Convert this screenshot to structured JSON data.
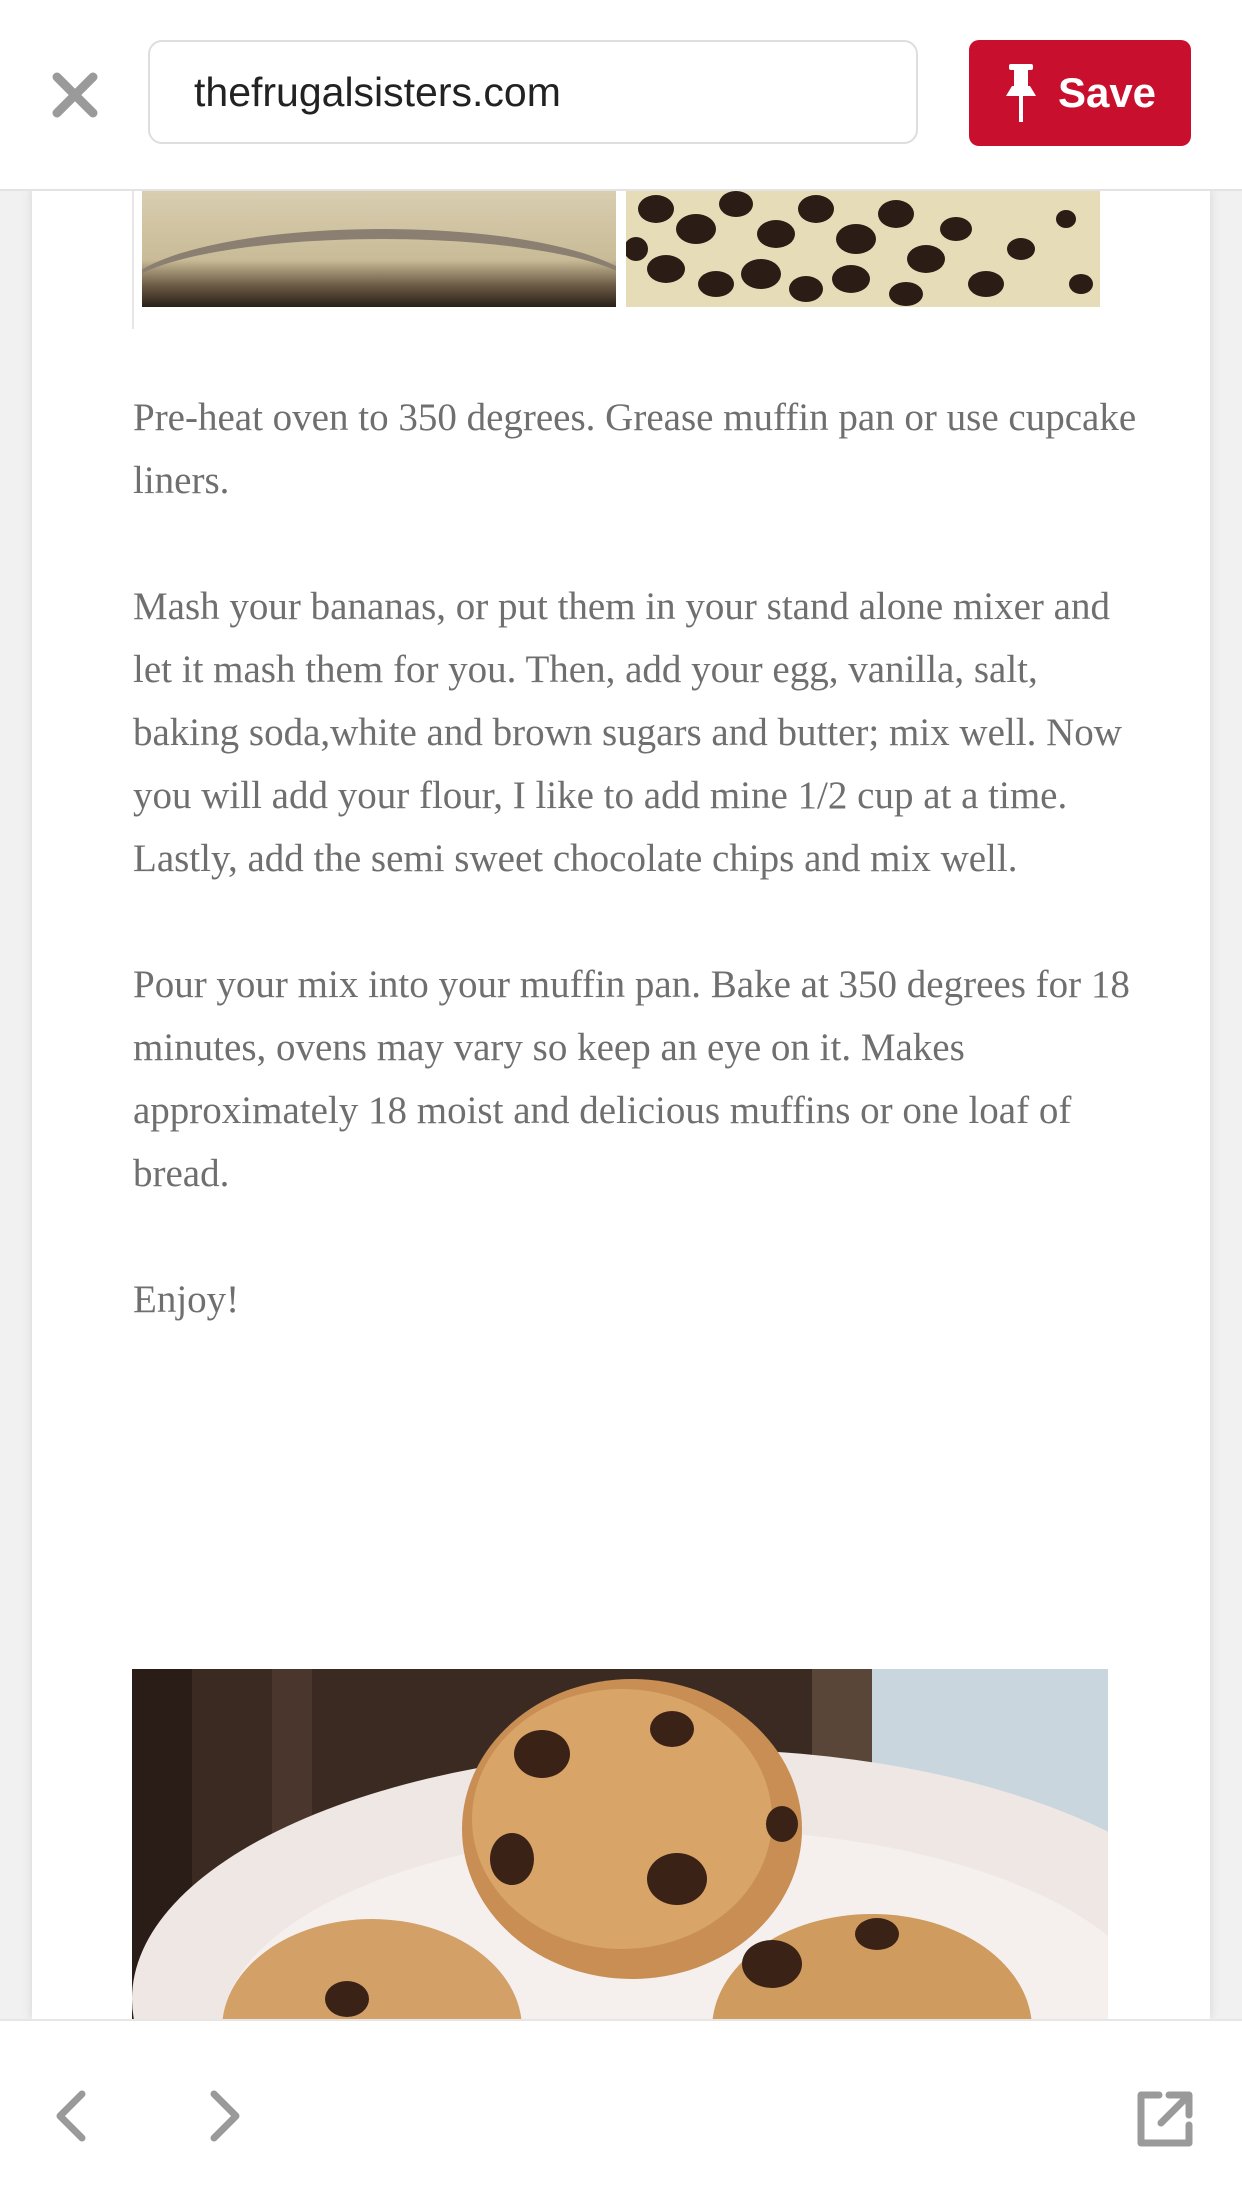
{
  "header": {
    "close_icon": "close-icon",
    "url": "thefrugalsisters.com",
    "save_label": "Save",
    "save_icon": "pushpin-icon",
    "save_color": "#c8102e"
  },
  "article": {
    "paragraphs": [
      "Pre-heat oven to 350 degrees.  Grease muffin pan or use cupcake liners.",
      "Mash your bananas, or put them in your stand alone mixer and let it mash them for you.  Then, add your egg, vanilla, salt, baking soda,white and brown sugars and butter; mix well.  Now you will add your flour, I like to add mine 1/2 cup at a time.  Lastly, add the semi sweet chocolate chips and mix well.",
      "Pour your mix into your muffin pan.  Bake at 350 degrees for 18 minutes, ovens may vary so keep an eye on it.  Makes approximately 18 moist and delicious muffins or one loaf of bread.",
      "Enjoy!"
    ],
    "text_color": "#6f6f6f"
  },
  "footer": {
    "back_icon": "chevron-left-icon",
    "forward_icon": "chevron-right-icon",
    "open_external_icon": "open-external-icon"
  }
}
